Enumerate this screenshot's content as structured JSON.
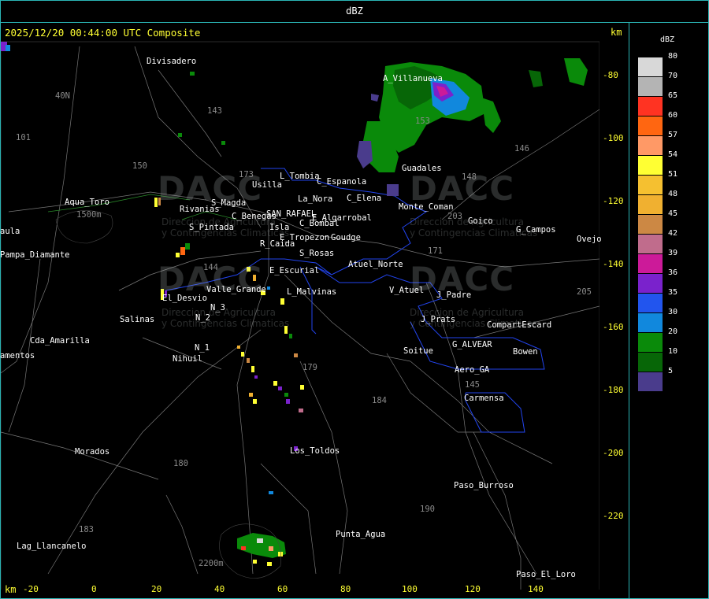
{
  "title": "dBZ",
  "header": {
    "timestamp": "2025/12/20 00:44:00 UTC Composite",
    "km_top": "km",
    "km_bottom": "km"
  },
  "x_ticks": [
    "-20",
    "0",
    "20",
    "40",
    "60",
    "80",
    "100",
    "120",
    "140"
  ],
  "y_ticks": [
    "-80",
    "-100",
    "-120",
    "-140",
    "-160",
    "-180",
    "-200",
    "-220"
  ],
  "legend": {
    "title": "dBZ",
    "items": [
      {
        "label": "80",
        "color": "#d8d8d8"
      },
      {
        "label": "70",
        "color": "#b4b4b4"
      },
      {
        "label": "65",
        "color": "#ff3322"
      },
      {
        "label": "60",
        "color": "#ff6611"
      },
      {
        "label": "57",
        "color": "#ff9966"
      },
      {
        "label": "54",
        "color": "#ffff33"
      },
      {
        "label": "51",
        "color": "#f5c030"
      },
      {
        "label": "48",
        "color": "#f0b030"
      },
      {
        "label": "45",
        "color": "#cc8844"
      },
      {
        "label": "42",
        "color": "#c06c8c"
      },
      {
        "label": "39",
        "color": "#cc1a99"
      },
      {
        "label": "36",
        "color": "#7a22cc"
      },
      {
        "label": "35",
        "color": "#2255ee"
      },
      {
        "label": "30",
        "color": "#1188dd"
      },
      {
        "label": "20",
        "color": "#0a8a0a"
      },
      {
        "label": "10",
        "color": "#076607"
      },
      {
        "label": "5",
        "color": "#4a3c8c"
      }
    ]
  },
  "places": [
    {
      "label": "Divisadero"
    },
    {
      "label": "A_Villanueva"
    },
    {
      "label": "Guadales"
    },
    {
      "label": "Aqua_Toro"
    },
    {
      "label": "Usilla"
    },
    {
      "label": "L_Tombia"
    },
    {
      "label": "La_Nora"
    },
    {
      "label": "C_Espanola"
    },
    {
      "label": "C_Elena"
    },
    {
      "label": "S_Magda"
    },
    {
      "label": "Rivanias"
    },
    {
      "label": "C_Benegas"
    },
    {
      "label": "SAN_RAFAEL"
    },
    {
      "label": "E_Algarrobal"
    },
    {
      "label": "C_Bombal"
    },
    {
      "label": "Isla"
    },
    {
      "label": "S_Pintada"
    },
    {
      "label": "E_Tropezon"
    },
    {
      "label": "Goudge"
    },
    {
      "label": "R_Caida"
    },
    {
      "label": "S_Rosas"
    },
    {
      "label": "Atuel_Norte"
    },
    {
      "label": "E_Escurial"
    },
    {
      "label": "Valle_Grande"
    },
    {
      "label": "L_Malvinas"
    },
    {
      "label": "El_Desvio"
    },
    {
      "label": "V_Atuel"
    },
    {
      "label": "J_Padre"
    },
    {
      "label": "Salinas"
    },
    {
      "label": "N_2"
    },
    {
      "label": "N_3"
    },
    {
      "label": "J_Prats"
    },
    {
      "label": "CompartEscard"
    },
    {
      "label": "Cda_Amarilla"
    },
    {
      "label": "N_1"
    },
    {
      "label": "G_ALVEAR"
    },
    {
      "label": "Bowen"
    },
    {
      "label": "Soitue"
    },
    {
      "label": "Nihuil"
    },
    {
      "label": "Aero_GA"
    },
    {
      "label": "Carmensa"
    },
    {
      "label": "Morados"
    },
    {
      "label": "Los_Toldos"
    },
    {
      "label": "Paso_Burroso"
    },
    {
      "label": "Punta_Agua"
    },
    {
      "label": "Lag_Llancanelo"
    },
    {
      "label": "Paso_El_Loro"
    },
    {
      "label": "Goico"
    },
    {
      "label": "G_Campos"
    },
    {
      "label": "Ovejo"
    },
    {
      "label": "Pampa_Diamante"
    },
    {
      "label": "aula"
    },
    {
      "label": "amentos"
    },
    {
      "label": "1500m"
    },
    {
      "label": "2200m"
    },
    {
      "label": "Monte_Coman"
    },
    {
      "label": "40N"
    }
  ],
  "routes": [
    {
      "label": "143"
    },
    {
      "label": "101"
    },
    {
      "label": "40N"
    },
    {
      "label": "150"
    },
    {
      "label": "153"
    },
    {
      "label": "146"
    },
    {
      "label": "144"
    },
    {
      "label": "203"
    },
    {
      "label": "148"
    },
    {
      "label": "171"
    },
    {
      "label": "173"
    },
    {
      "label": "184"
    },
    {
      "label": "180"
    },
    {
      "label": "183"
    },
    {
      "label": "179"
    },
    {
      "label": "190"
    },
    {
      "label": "205"
    },
    {
      "label": "145"
    }
  ],
  "watermark": {
    "name": "DACC",
    "sub_line1": "Direccion de Agricultura",
    "sub_line2": "y Contingencias Climaticas"
  }
}
